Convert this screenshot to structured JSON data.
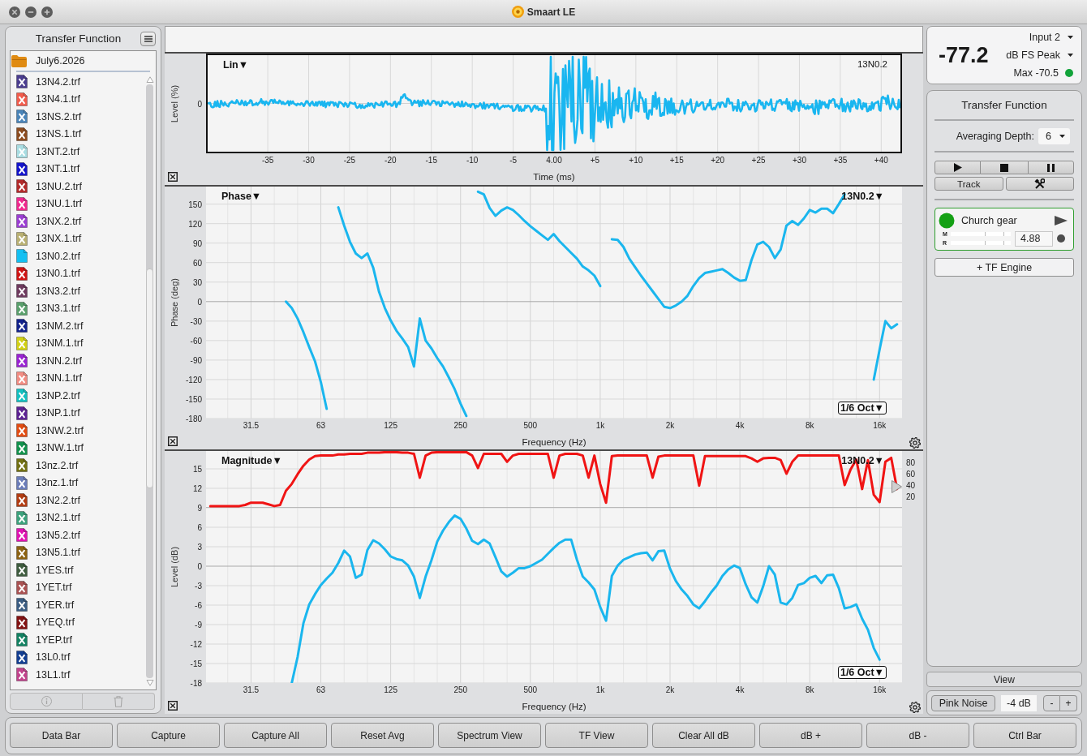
{
  "window": {
    "title": "Smaart LE"
  },
  "sidebar": {
    "title": "Transfer Function",
    "folder": "July6.2026",
    "files": [
      {
        "name": "13N4.2.trf",
        "color": "#4b3d8f",
        "hidden": true
      },
      {
        "name": "13N4.1.trf",
        "color": "#f25c4c",
        "hidden": true
      },
      {
        "name": "13NS.2.trf",
        "color": "#4a84b8",
        "hidden": true
      },
      {
        "name": "13NS.1.trf",
        "color": "#8c4b1e",
        "hidden": true
      },
      {
        "name": "13NT.2.trf",
        "color": "#a9dde2",
        "hidden": true
      },
      {
        "name": "13NT.1.trf",
        "color": "#1414cc",
        "hidden": true
      },
      {
        "name": "13NU.2.trf",
        "color": "#b22a2a",
        "hidden": true
      },
      {
        "name": "13NU.1.trf",
        "color": "#f0288e",
        "hidden": true
      },
      {
        "name": "13NX.2.trf",
        "color": "#9b3ed2",
        "hidden": true
      },
      {
        "name": "13NX.1.trf",
        "color": "#b9b072",
        "hidden": true
      },
      {
        "name": "13N0.2.trf",
        "color": "#14c0f2",
        "hidden": false
      },
      {
        "name": "13N0.1.trf",
        "color": "#d01414",
        "hidden": true
      },
      {
        "name": "13N3.2.trf",
        "color": "#6e3a5e",
        "hidden": true
      },
      {
        "name": "13N3.1.trf",
        "color": "#5aa06c",
        "hidden": true
      },
      {
        "name": "13NM.2.trf",
        "color": "#12228c",
        "hidden": true
      },
      {
        "name": "13NM.1.trf",
        "color": "#d2d014",
        "hidden": true
      },
      {
        "name": "13NN.2.trf",
        "color": "#9a22d2",
        "hidden": true
      },
      {
        "name": "13NN.1.trf",
        "color": "#f28c82",
        "hidden": true
      },
      {
        "name": "13NP.2.trf",
        "color": "#12c0c0",
        "hidden": true
      },
      {
        "name": "13NP.1.trf",
        "color": "#5c2292",
        "hidden": true
      },
      {
        "name": "13NW.2.trf",
        "color": "#e24c12",
        "hidden": true
      },
      {
        "name": "13NW.1.trf",
        "color": "#12924c",
        "hidden": true
      },
      {
        "name": "13nz.2.trf",
        "color": "#727012",
        "hidden": true
      },
      {
        "name": "13nz.1.trf",
        "color": "#6a7cb8",
        "hidden": true
      },
      {
        "name": "13N2.2.trf",
        "color": "#b23c12",
        "hidden": true
      },
      {
        "name": "13N2.1.trf",
        "color": "#3ca27c",
        "hidden": true
      },
      {
        "name": "13N5.2.trf",
        "color": "#e012b2",
        "hidden": true
      },
      {
        "name": "13N5.1.trf",
        "color": "#8c6212",
        "hidden": true
      },
      {
        "name": "1YES.trf",
        "color": "#3e5c3e",
        "hidden": true
      },
      {
        "name": "1YET.trf",
        "color": "#aa5252",
        "hidden": true
      },
      {
        "name": "1YER.trf",
        "color": "#3a5c82",
        "hidden": true
      },
      {
        "name": "1YEQ.trf",
        "color": "#821212",
        "hidden": true
      },
      {
        "name": "1YEP.trf",
        "color": "#128262",
        "hidden": true
      },
      {
        "name": "13L0.trf",
        "color": "#123e92",
        "hidden": true
      },
      {
        "name": "13L1.trf",
        "color": "#c2428c",
        "hidden": true
      }
    ]
  },
  "plots": [
    {
      "kind": "impulse",
      "scale": "Lin▼",
      "trace": "13N0.2",
      "ylabel": "Level (%)",
      "xlabel": "Time (ms)",
      "ytick_labels": [
        "0"
      ],
      "xtick_labels": [
        "-35",
        "-30",
        "-25",
        "-20",
        "-15",
        "-10",
        "-5",
        "4.00",
        "+5",
        "+10",
        "+15",
        "+20",
        "+25",
        "+30",
        "+35",
        "+40"
      ]
    },
    {
      "kind": "frequency",
      "mode": "Phase▼",
      "trace": "13N0.2▼",
      "smoothing": "1/6 Oct▼",
      "chart_data": {
        "type": "line",
        "xlabel": "Frequency (Hz)",
        "ylabel": "Phase (deg)",
        "grid": true,
        "categories": [
          null,
          null,
          null,
          null,
          null,
          null,
          null,
          "31.5",
          null,
          null,
          null,
          null,
          null,
          null,
          null,
          null,
          null,
          null,
          null,
          "63",
          null,
          null,
          null,
          null,
          null,
          null,
          null,
          null,
          null,
          null,
          null,
          "125",
          null,
          null,
          null,
          null,
          null,
          null,
          null,
          null,
          null,
          null,
          null,
          "250",
          null,
          null,
          null,
          null,
          null,
          null,
          null,
          null,
          null,
          null,
          null,
          "500",
          null,
          null,
          null,
          null,
          null,
          null,
          null,
          null,
          null,
          null,
          null,
          "1k",
          null,
          null,
          null,
          null,
          null,
          null,
          null,
          null,
          null,
          null,
          null,
          "2k",
          null,
          null,
          null,
          null,
          null,
          null,
          null,
          null,
          null,
          null,
          null,
          "4k",
          null,
          null,
          null,
          null,
          null,
          null,
          null,
          null,
          null,
          null,
          null,
          "8k",
          null,
          null,
          null,
          null,
          null,
          null,
          null,
          null,
          null,
          null,
          null,
          "16k",
          null,
          null,
          null
        ],
        "series": [
          {
            "color": "#1ab6ee",
            "values": [
              null,
              null,
              null,
              null,
              null,
              null,
              null,
              null,
              null,
              null,
              null,
              null,
              null,
              0,
              -10,
              -26,
              -47,
              -70,
              -92,
              -124,
              -165,
              null,
              145,
              117,
              92,
              74,
              67,
              74,
              52,
              15,
              -10,
              -29,
              -45,
              -57,
              -70,
              -100,
              -26,
              -60,
              -72,
              -87,
              -100,
              -117,
              -135,
              -157,
              -176,
              null,
              169,
              165,
              144,
              132,
              140,
              145,
              141,
              133,
              124,
              116,
              109,
              102,
              95,
              104,
              93,
              84,
              75,
              66,
              54,
              48,
              40,
              24,
              null,
              96,
              95,
              84,
              66,
              53,
              40,
              28,
              16,
              4,
              -8,
              -10,
              -6,
              0,
              9,
              24,
              36,
              44,
              46,
              48,
              50,
              44,
              37,
              32,
              33,
              64,
              88,
              92,
              84,
              67,
              80,
              117,
              124,
              118,
              128,
              141,
              137,
              143,
              143,
              136,
              150,
              165,
              null,
              null,
              null,
              null,
              -120,
              -74,
              -30,
              -41,
              -35
            ]
          }
        ],
        "ylim": [
          -180,
          177
        ],
        "yticks": [
          150,
          120,
          90,
          60,
          30,
          0,
          -30,
          -60,
          -90,
          -120,
          -150,
          -180
        ]
      }
    },
    {
      "kind": "frequency",
      "mode": "Magnitude▼",
      "trace": "13N0.2▼",
      "smoothing": "1/6 Oct▼",
      "chart_data": {
        "type": "line",
        "xlabel": "Frequency (Hz)",
        "ylabel": "Level (dB)",
        "grid": true,
        "categories": [
          null,
          null,
          null,
          null,
          null,
          null,
          null,
          "31.5",
          null,
          null,
          null,
          null,
          null,
          null,
          null,
          null,
          null,
          null,
          null,
          "63",
          null,
          null,
          null,
          null,
          null,
          null,
          null,
          null,
          null,
          null,
          null,
          "125",
          null,
          null,
          null,
          null,
          null,
          null,
          null,
          null,
          null,
          null,
          null,
          "250",
          null,
          null,
          null,
          null,
          null,
          null,
          null,
          null,
          null,
          null,
          null,
          "500",
          null,
          null,
          null,
          null,
          null,
          null,
          null,
          null,
          null,
          null,
          null,
          "1k",
          null,
          null,
          null,
          null,
          null,
          null,
          null,
          null,
          null,
          null,
          null,
          "2k",
          null,
          null,
          null,
          null,
          null,
          null,
          null,
          null,
          null,
          null,
          null,
          "4k",
          null,
          null,
          null,
          null,
          null,
          null,
          null,
          null,
          null,
          null,
          null,
          "8k",
          null,
          null,
          null,
          null,
          null,
          null,
          null,
          null,
          null,
          null,
          null,
          "16k",
          null,
          null,
          null
        ],
        "series": [
          {
            "color": "#1ab6ee",
            "values": [
              null,
              null,
              null,
              null,
              null,
              null,
              null,
              null,
              null,
              null,
              null,
              null,
              null,
              null,
              -18,
              -14,
              -8.8,
              -5.9,
              -4.3,
              -2.9,
              -1.9,
              -1,
              0.5,
              2.4,
              1.5,
              -1.8,
              -1.3,
              2.5,
              4,
              3.5,
              2.6,
              1.5,
              1.1,
              0.9,
              0.1,
              -1.6,
              -4.9,
              -1.6,
              0.9,
              3.8,
              5.5,
              6.8,
              7.8,
              7.3,
              5.8,
              3.9,
              3.4,
              4.1,
              3.5,
              1.4,
              -0.8,
              -1.6,
              -1,
              -0.3,
              -0.3,
              0,
              0.5,
              1,
              1.9,
              2.8,
              3.6,
              4.1,
              4.1,
              1,
              -1.6,
              -2.5,
              -3.6,
              -6.3,
              -8.4,
              -1.5,
              0.1,
              1,
              1.4,
              1.8,
              2,
              2.1,
              0.9,
              2.3,
              2.4,
              -0.4,
              -2.3,
              -3.6,
              -4.6,
              -5.9,
              -6.5,
              -5.4,
              -4.1,
              -3,
              -1.5,
              -0.5,
              0.1,
              -0.3,
              -2.8,
              -4.8,
              -5.6,
              -3.1,
              0,
              -1.3,
              -5.6,
              -5.9,
              -4.9,
              -2.9,
              -2.6,
              -1.8,
              -1.5,
              -2.6,
              -1.4,
              -1.3,
              -3.4,
              -6.5,
              -6.3,
              -5.9,
              -8.1,
              -9.8,
              -12.6,
              -14.4,
              null,
              null,
              null
            ]
          }
        ],
        "ylim": [
          -18,
          17.75
        ],
        "yticks": [
          15,
          12,
          9,
          6,
          3,
          0,
          -3,
          -6,
          -9,
          -12,
          -15,
          -18
        ]
      },
      "overlay": {
        "chart_data": {
          "type": "line",
          "categories": [
            null,
            null,
            null,
            null,
            null,
            null,
            null,
            null,
            null,
            null,
            null,
            null,
            null,
            null,
            null,
            null,
            null,
            null,
            null,
            null,
            null,
            null,
            null,
            null,
            null,
            null,
            null,
            null,
            null,
            null,
            null,
            null,
            null,
            null,
            null,
            null,
            null,
            null,
            null,
            null,
            null,
            null,
            null,
            null,
            null,
            null,
            null,
            null,
            null,
            null,
            null,
            null,
            null,
            null,
            null,
            null,
            null,
            null,
            null,
            null,
            null,
            null,
            null,
            null,
            null,
            null,
            null,
            null,
            null,
            null,
            null,
            null,
            null,
            null,
            null,
            null,
            null,
            null,
            null,
            null,
            null,
            null,
            null,
            null,
            null,
            null,
            null,
            null,
            null,
            null,
            null,
            null,
            null,
            null,
            null,
            null,
            null,
            null,
            null,
            null,
            null,
            null,
            null,
            null,
            null,
            null,
            null,
            null,
            null,
            null,
            null,
            null,
            null,
            null,
            null,
            null,
            null,
            null,
            null
          ],
          "series": [
            {
              "color": "#f01414",
              "values": [
                3,
                3,
                3,
                3,
                3,
                3,
                5,
                9,
                9,
                9,
                6,
                3,
                5,
                30,
                42,
                59,
                74,
                85,
                91,
                92,
                92,
                92,
                94,
                94,
                95,
                95,
                95,
                97,
                97,
                97,
                98,
                98,
                98,
                97,
                97,
                95,
                53,
                92,
                97,
                98,
                98,
                98,
                98,
                98,
                98,
                92,
                70,
                95,
                95,
                95,
                95,
                81,
                92,
                95,
                95,
                95,
                95,
                95,
                95,
                53,
                92,
                95,
                95,
                95,
                92,
                53,
                92,
                42,
                9,
                91,
                92,
                92,
                92,
                92,
                92,
                92,
                53,
                90,
                92,
                92,
                92,
                92,
                92,
                92,
                39,
                91,
                91,
                91,
                91,
                91,
                91,
                91,
                91,
                87,
                81,
                87,
                88,
                88,
                84,
                60,
                81,
                92,
                92,
                92,
                92,
                92,
                92,
                92,
                92,
                40,
                67,
                85,
                33,
                84,
                23,
                10,
                81,
                88,
                33
              ]
            }
          ],
          "ylim": [
            0,
            100
          ],
          "yticks": [
            80,
            60,
            40,
            20
          ]
        }
      }
    }
  ],
  "meter": {
    "reading": "-77.2",
    "input": "Input 2",
    "unit": "dB FS Peak",
    "max": "Max -70.5",
    "clipping": false
  },
  "engine": {
    "title": "Transfer Function",
    "averaging_label": "Averaging Depth:",
    "averaging_value": "6",
    "track_button": "Track",
    "measurement": {
      "name": "Church gear",
      "running": true,
      "meters": [
        "M",
        "R"
      ],
      "delay": "4.88"
    },
    "add_button": "+ TF Engine"
  },
  "view_button": "View",
  "generator": {
    "button": "Pink Noise",
    "gain": "-4 dB",
    "steppers": [
      "-",
      "+"
    ]
  },
  "control_bar": [
    "Data Bar",
    "Capture",
    "Capture All",
    "Reset Avg",
    "Spectrum View",
    "TF View",
    "Clear All dB",
    "dB +",
    "dB -",
    "Ctrl Bar"
  ]
}
